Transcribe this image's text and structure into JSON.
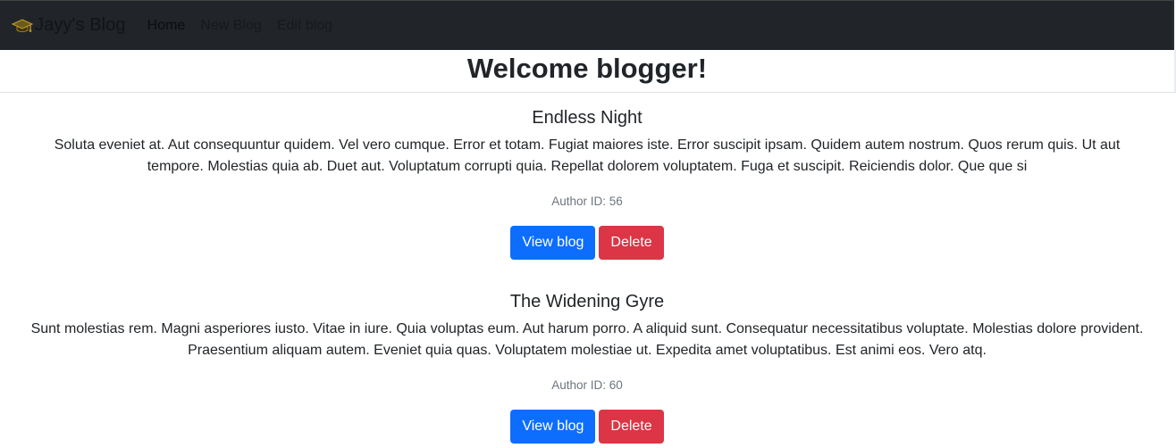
{
  "navbar": {
    "brand_icon": "graduation-cap-icon",
    "brand": "Jayy's Blog",
    "links": [
      {
        "label": "Home",
        "active": true
      },
      {
        "label": "New Blog",
        "active": false
      },
      {
        "label": "Edit blog",
        "active": false
      }
    ],
    "background": "#212529"
  },
  "hero": {
    "title": "Welcome blogger!"
  },
  "posts": [
    {
      "title": "Endless Night",
      "body": "Soluta eveniet at. Aut consequuntur quidem. Vel vero cumque. Error et totam. Fugiat maiores iste. Error suscipit ipsam. Quidem autem nostrum. Quos rerum quis. Ut aut tempore. Molestias quia ab. Duet aut. Voluptatum corrupti quia. Repellat dolorem voluptatem. Fuga et suscipit. Reiciendis dolor. Que que si",
      "author": "Author ID: 56",
      "view_label": "View blog",
      "delete_label": "Delete"
    },
    {
      "title": "The Widening Gyre",
      "body": "Sunt molestias rem. Magni asperiores iusto. Vitae in iure. Quia voluptas eum. Aut harum porro. A aliquid sunt. Consequatur necessitatibus voluptate. Molestias dolore provident. Praesentium aliquam autem. Eveniet quia quas. Voluptatem molestiae ut. Expedita amet voluptatibus. Est animi eos. Vero atq.",
      "author": "Author ID: 60",
      "view_label": "View blog",
      "delete_label": "Delete"
    }
  ],
  "colors": {
    "primary": "#0d6efd",
    "danger": "#dc3545",
    "muted_text": "#6c757d"
  }
}
